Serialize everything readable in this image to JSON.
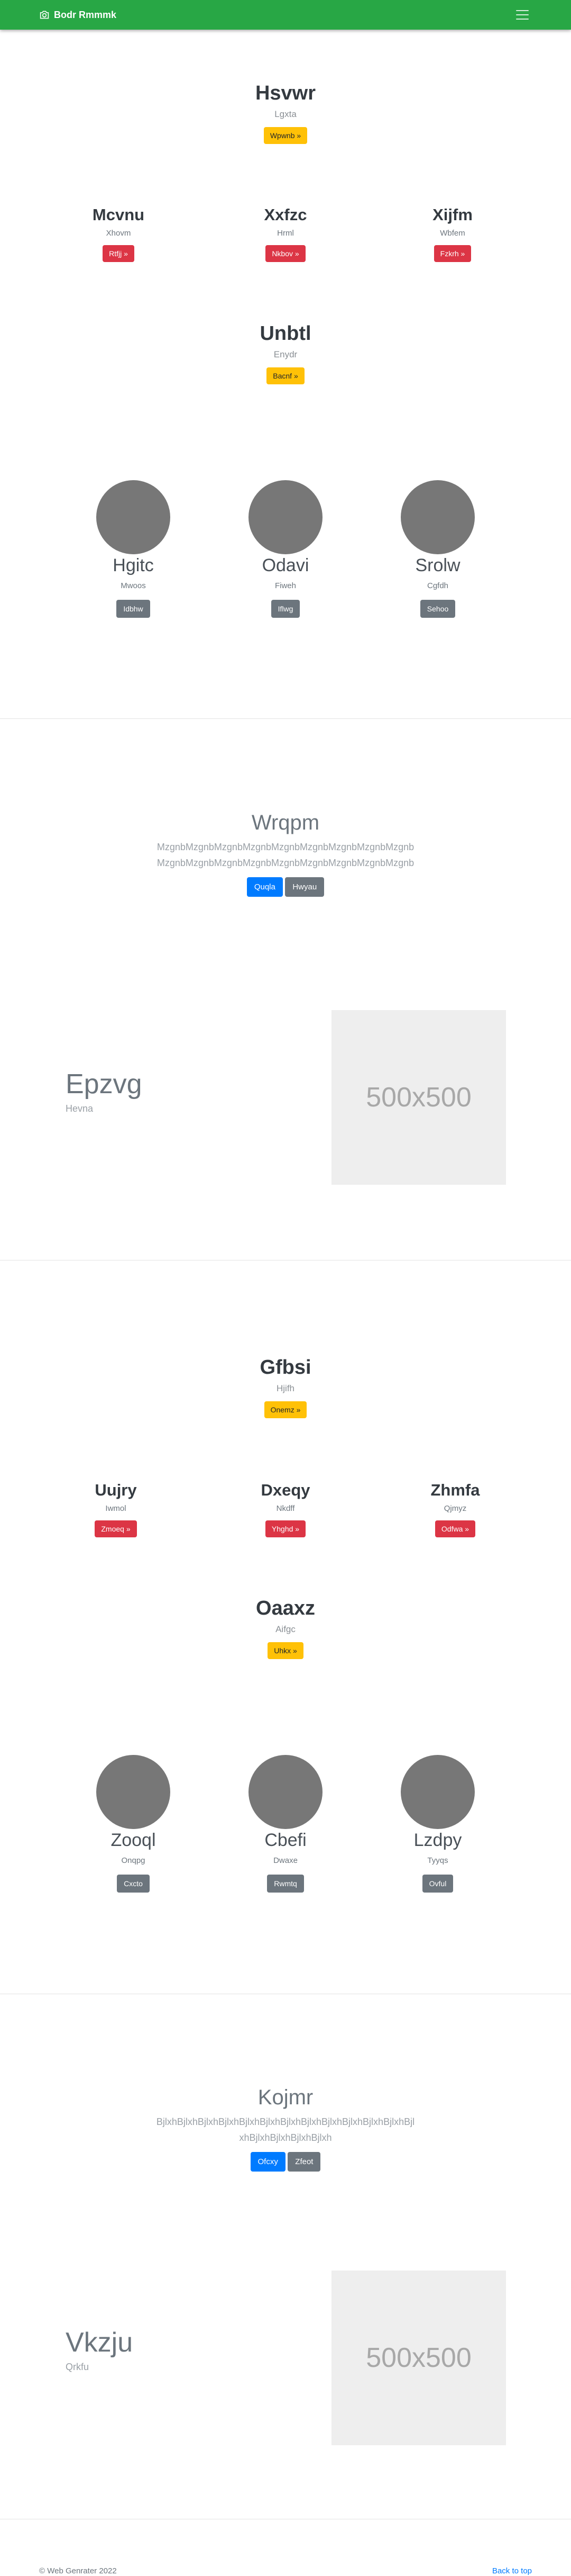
{
  "navbar": {
    "brand": "Bodr Rmmmk",
    "brand_icon": "camera-icon",
    "toggler_icon": "hamburger-icon"
  },
  "section1": {
    "hero": {
      "title": "Hsvwr",
      "subtitle": "Lgxta",
      "button": "Wpwnb »"
    },
    "columns": [
      {
        "title": "Mcvnu",
        "subtitle": "Xhovm",
        "button": "Rtfjj »"
      },
      {
        "title": "Xxfzc",
        "subtitle": "Hrml",
        "button": "Nkbov »"
      },
      {
        "title": "Xijfm",
        "subtitle": "Wbfem",
        "button": "Fzkrh »"
      }
    ],
    "hero2": {
      "title": "Unbtl",
      "subtitle": "Enydr",
      "button": "Bacnf »"
    },
    "team": [
      {
        "name": "Hgitc",
        "role": "Mwoos",
        "button": "Idbhw"
      },
      {
        "name": "Odavi",
        "role": "Fiweh",
        "button": "Iflwg"
      },
      {
        "name": "Srolw",
        "role": "Cgfdh",
        "button": "Sehoo"
      }
    ]
  },
  "cta1": {
    "title": "Wrqpm",
    "paragraph": "MzgnbMzgnbMzgnbMzgnbMzgnbMzgnbMzgnbMzgnbMzgnbMzgnbMzgnbMzgnbMzgnbMzgnbMzgnbMzgnbMzgnbMzgnb",
    "primary_button": "Quqla",
    "secondary_button": "Hwyau"
  },
  "feature1": {
    "title": "Epzvg",
    "subtitle": "Hevna",
    "image_text": "500x500"
  },
  "section2": {
    "hero": {
      "title": "Gfbsi",
      "subtitle": "Hjifh",
      "button": "Onemz »"
    },
    "columns": [
      {
        "title": "Uujry",
        "subtitle": "Iwmol",
        "button": "Zmoeq »"
      },
      {
        "title": "Dxeqy",
        "subtitle": "Nkdff",
        "button": "Yhghd »"
      },
      {
        "title": "Zhmfa",
        "subtitle": "Qjmyz",
        "button": "Odfwa »"
      }
    ],
    "hero2": {
      "title": "Oaaxz",
      "subtitle": "Aifgc",
      "button": "Uhkx »"
    },
    "team": [
      {
        "name": "Zooql",
        "role": "Onqpg",
        "button": "Cxcto"
      },
      {
        "name": "Cbefi",
        "role": "Dwaxe",
        "button": "Rwmtq"
      },
      {
        "name": "Lzdpy",
        "role": "Tyyqs",
        "button": "Ovful"
      }
    ]
  },
  "cta2": {
    "title": "Kojmr",
    "paragraph": "BjlxhBjlxhBjlxhBjlxhBjlxhBjlxhBjlxhBjlxhBjlxhBjlxhBjlxhBjlxhBjlxhBjlxhBjlxhBjlxhBjlxh",
    "primary_button": "Ofcxy",
    "secondary_button": "Zfeot"
  },
  "feature2": {
    "title": "Vkzju",
    "subtitle": "Qrkfu",
    "image_text": "500x500"
  },
  "footer": {
    "copyright": "© Web Genrater 2022",
    "back_to_top": "Back to top"
  }
}
